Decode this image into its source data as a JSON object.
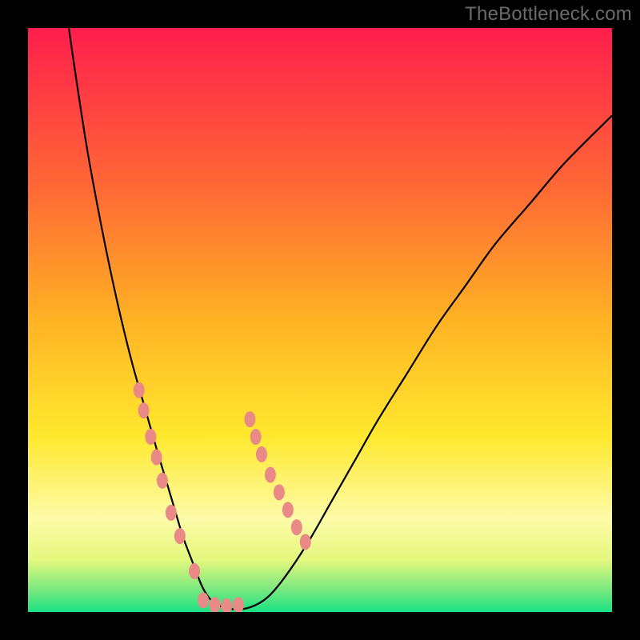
{
  "watermark": "TheBottleneck.com",
  "chart_data": {
    "type": "line",
    "title": "",
    "xlabel": "",
    "ylabel": "",
    "xlim": [
      0,
      100
    ],
    "ylim": [
      0,
      100
    ],
    "background": {
      "type": "vertical-gradient",
      "stops": [
        {
          "pos": 0.0,
          "color": "#ff1e4d"
        },
        {
          "pos": 0.28,
          "color": "#ff6a34"
        },
        {
          "pos": 0.5,
          "color": "#ffb224"
        },
        {
          "pos": 0.7,
          "color": "#ffe92e"
        },
        {
          "pos": 0.84,
          "color": "#fdfba8"
        },
        {
          "pos": 0.91,
          "color": "#e5f87e"
        },
        {
          "pos": 0.96,
          "color": "#7de97f"
        },
        {
          "pos": 1.0,
          "color": "#19e184"
        }
      ]
    },
    "series": [
      {
        "name": "bottleneck-curve",
        "description": "V-shaped curve; left branch descends steeply from top-left, right branch rises with decreasing slope toward upper-right",
        "x": [
          7,
          8,
          10,
          12,
          14,
          16,
          18,
          20,
          22,
          23.5,
          25,
          26.5,
          28,
          30,
          32,
          35,
          38,
          41,
          44,
          48,
          52,
          56,
          60,
          65,
          70,
          75,
          80,
          86,
          92,
          100
        ],
        "y": [
          100,
          93,
          80,
          69,
          59,
          50,
          42,
          35,
          28,
          23,
          18,
          13,
          9,
          4,
          1.5,
          0.5,
          0.8,
          2.5,
          6,
          12,
          19,
          26,
          33,
          41,
          49,
          56,
          63,
          70,
          77,
          85
        ]
      },
      {
        "name": "markers-left-branch",
        "type": "scatter",
        "color": "#e98a87",
        "x": [
          19.0,
          19.8,
          21.0,
          22.0,
          23.0,
          24.5,
          26.0,
          28.5
        ],
        "y": [
          38.0,
          34.5,
          30.0,
          26.5,
          22.5,
          17.0,
          13.0,
          7.0
        ]
      },
      {
        "name": "markers-right-branch",
        "type": "scatter",
        "color": "#e98a87",
        "x": [
          38.0,
          39.0,
          40.0,
          41.5,
          43.0,
          44.5,
          46.0,
          47.5
        ],
        "y": [
          33.0,
          30.0,
          27.0,
          23.5,
          20.5,
          17.5,
          14.5,
          12.0
        ]
      },
      {
        "name": "markers-bottom",
        "type": "scatter",
        "color": "#e98a87",
        "x": [
          30.0,
          32.0,
          34.0,
          36.0
        ],
        "y": [
          2.0,
          1.2,
          1.0,
          1.2
        ]
      }
    ]
  }
}
